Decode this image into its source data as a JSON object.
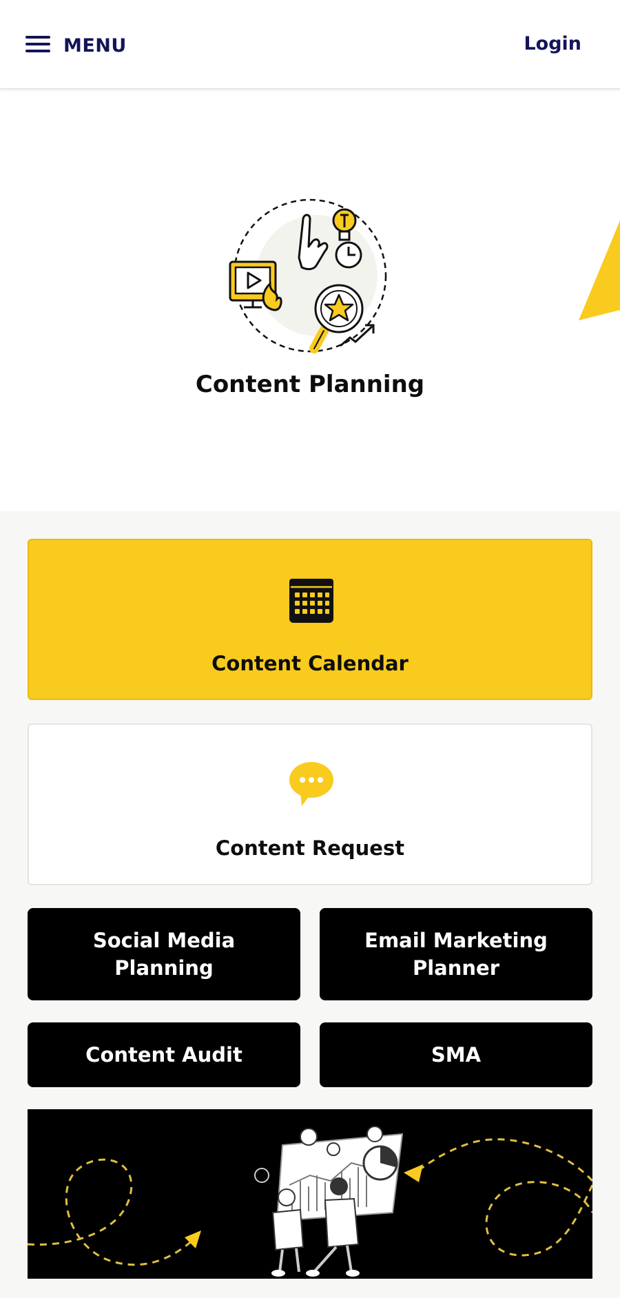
{
  "header": {
    "menu_label": "MENU",
    "login_label": "Login"
  },
  "hero": {
    "title": "Content Planning"
  },
  "cards": [
    {
      "label": "Content Calendar",
      "icon": "calendar-icon"
    },
    {
      "label": "Content Request",
      "icon": "chat-bubble-icon"
    }
  ],
  "buttons": [
    {
      "line1": "Social Media",
      "line2": "Planning"
    },
    {
      "line1": "Email Marketing",
      "line2": "Planner"
    },
    {
      "line1": "Content Audit"
    },
    {
      "line1": "SMA"
    }
  ],
  "colors": {
    "accent": "#f9cb1f",
    "nav_text": "#14145a",
    "dark": "#000000",
    "background": "#f7f7f5"
  }
}
